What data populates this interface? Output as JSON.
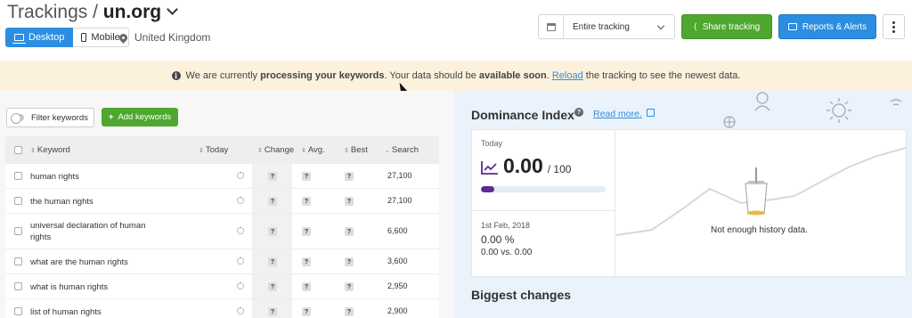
{
  "header": {
    "title_prefix": "Trackings / ",
    "title_domain": "un.org",
    "devices": [
      "Desktop",
      "Mobile"
    ],
    "location": "United Kingdom",
    "date_range": "Entire tracking",
    "share_label": "Share tracking",
    "reports_label": "Reports & Alerts"
  },
  "notice": {
    "part1": "We are currently ",
    "bold1": "processing your keywords",
    "part2": ". Your data should be ",
    "bold2": "available soon",
    "part3": ". ",
    "link": "Reload",
    "part4": " the tracking to see the newest data."
  },
  "keywords_panel": {
    "filter_label": "Filter keywords",
    "add_label": "Add keywords",
    "columns": [
      "Keyword",
      "Today",
      "Change",
      "Avg.",
      "Best",
      "Search"
    ],
    "rows": [
      {
        "keyword": [
          "human rights"
        ],
        "change": "?",
        "avg": "?",
        "best": "?",
        "search": "27,100"
      },
      {
        "keyword": [
          "the human rights"
        ],
        "change": "?",
        "avg": "?",
        "best": "?",
        "search": "27,100"
      },
      {
        "keyword": [
          "universal declaration of human",
          "rights"
        ],
        "change": "?",
        "avg": "?",
        "best": "?",
        "search": "6,600"
      },
      {
        "keyword": [
          "what are the human rights"
        ],
        "change": "?",
        "avg": "?",
        "best": "?",
        "search": "3,600"
      },
      {
        "keyword": [
          "what is human rights"
        ],
        "change": "?",
        "avg": "?",
        "best": "?",
        "search": "2,950"
      },
      {
        "keyword": [
          "list of human rights"
        ],
        "change": "?",
        "avg": "?",
        "best": "?",
        "search": "2,900"
      }
    ]
  },
  "dominance": {
    "title": "Dominance Index",
    "read_more": "Read more.",
    "today_label": "Today",
    "value": "0.00",
    "max": "/ 100",
    "progress_fraction": 0.0,
    "compare_date": "1st Feb, 2018",
    "compare_pct": "0.00 %",
    "compare_vs": "0.00 vs. 0.00",
    "no_history": "Not enough history data."
  },
  "biggest_changes": {
    "title": "Biggest changes"
  },
  "colors": {
    "green": "#4fa72f",
    "blue": "#2c8ee0",
    "notice_bg": "#fbf1dc",
    "purple": "#5c2d91"
  }
}
